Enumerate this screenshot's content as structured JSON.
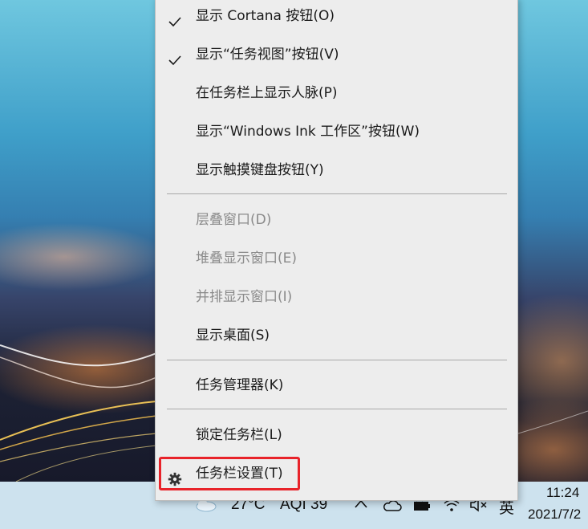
{
  "menu": {
    "items": [
      {
        "label": "显示 Cortana 按钮(O)",
        "checked": true,
        "enabled": true
      },
      {
        "label": "显示“任务视图”按钮(V)",
        "checked": true,
        "enabled": true
      },
      {
        "label": "在任务栏上显示人脉(P)",
        "checked": false,
        "enabled": true
      },
      {
        "label": "显示“Windows Ink 工作区”按钮(W)",
        "checked": false,
        "enabled": true
      },
      {
        "label": "显示触摸键盘按钮(Y)",
        "checked": false,
        "enabled": true
      },
      {
        "label": "层叠窗口(D)",
        "checked": false,
        "enabled": false
      },
      {
        "label": "堆叠显示窗口(E)",
        "checked": false,
        "enabled": false
      },
      {
        "label": "并排显示窗口(I)",
        "checked": false,
        "enabled": false
      },
      {
        "label": "显示桌面(S)",
        "checked": false,
        "enabled": true
      },
      {
        "label": "任务管理器(K)",
        "checked": false,
        "enabled": true
      },
      {
        "label": "锁定任务栏(L)",
        "checked": false,
        "enabled": true
      },
      {
        "label": "任务栏设置(T)",
        "checked": false,
        "enabled": true,
        "icon": "gear-icon",
        "highlighted": true
      }
    ]
  },
  "taskbar": {
    "weather_temp": "27°C",
    "aqi": "AQI 39",
    "ime": "英",
    "time": "11:24",
    "date": "2021/7/2"
  },
  "colors": {
    "highlight": "#e8232a",
    "menu_bg": "#ededed",
    "taskbar_bg": "#cde2ee",
    "disabled_text": "#8a8a8a"
  }
}
